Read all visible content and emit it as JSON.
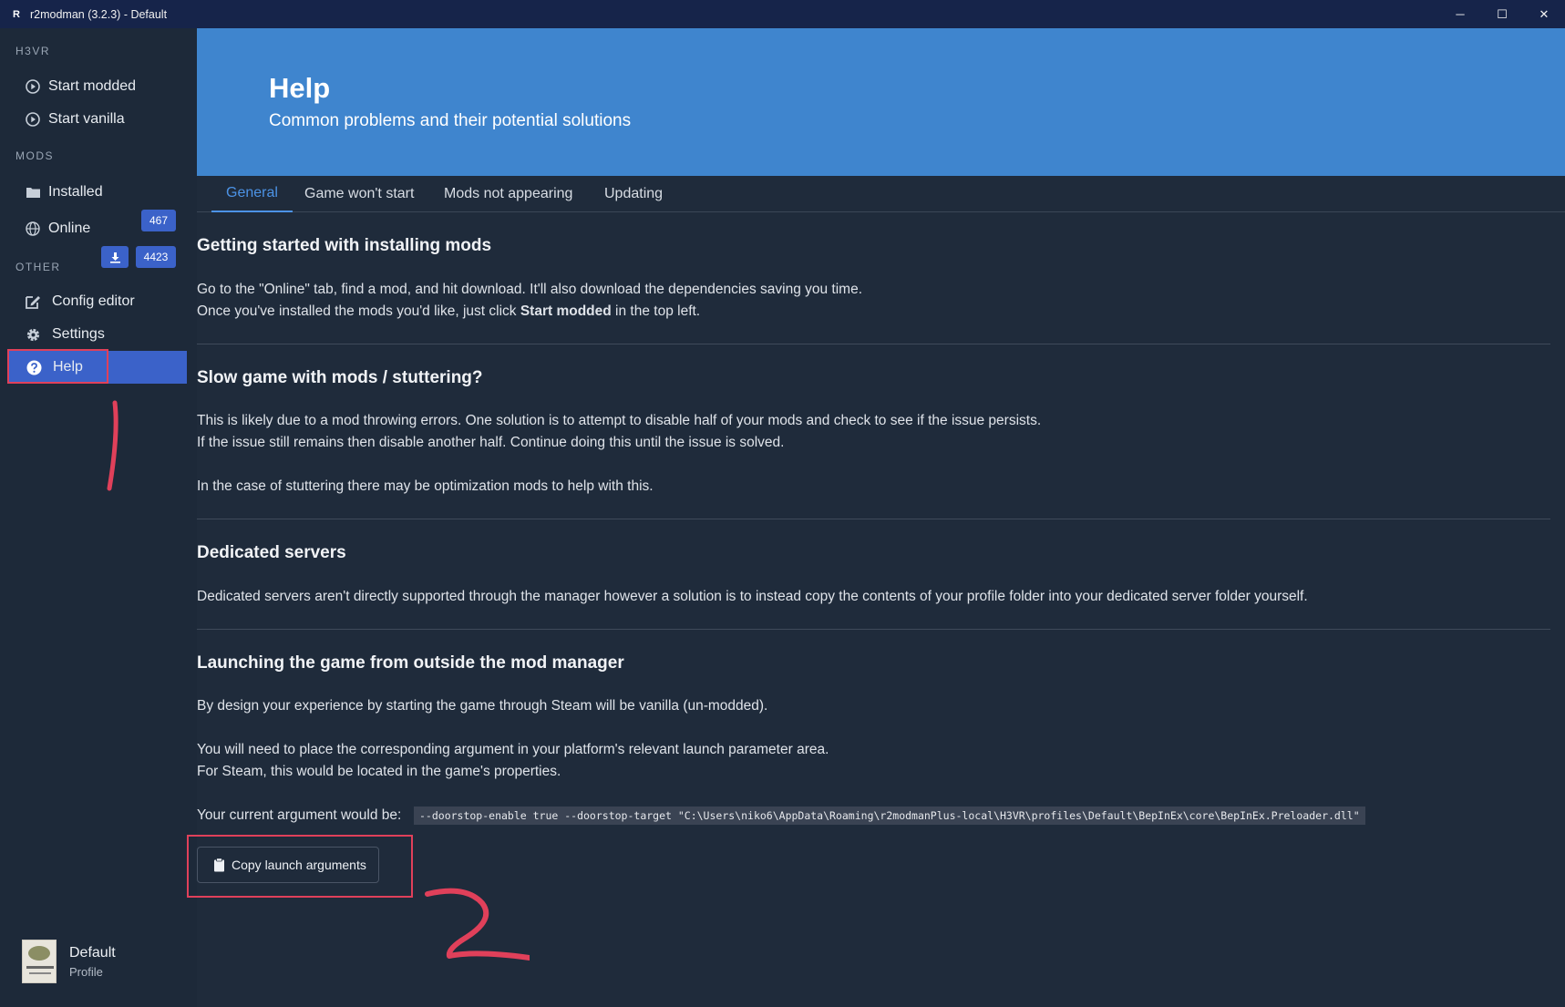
{
  "window": {
    "app_icon_letter": "R",
    "title": "r2modman (3.2.3) - Default",
    "controls": {
      "minimize": "─",
      "maximize": "☐",
      "close": "✕"
    }
  },
  "sidebar": {
    "game_section": "H3VR",
    "start_modded": "Start modded",
    "start_vanilla": "Start vanilla",
    "mods_section": "MODS",
    "installed": {
      "label": "Installed",
      "count": "467"
    },
    "online": {
      "label": "Online",
      "count": "4423"
    },
    "other_section": "OTHER",
    "config_editor": "Config editor",
    "settings": "Settings",
    "help": "Help",
    "profile": {
      "name": "Default",
      "sub": "Profile"
    }
  },
  "hero": {
    "title": "Help",
    "subtitle": "Common problems and their potential solutions"
  },
  "tabs": [
    {
      "label": "General",
      "active": true
    },
    {
      "label": "Game won't start",
      "active": false
    },
    {
      "label": "Mods not appearing",
      "active": false
    },
    {
      "label": "Updating",
      "active": false
    }
  ],
  "sections": {
    "getting_started": {
      "title": "Getting started with installing mods",
      "line1": "Go to the \"Online\" tab, find a mod, and hit download. It'll also download the dependencies saving you time.",
      "line2_pre": "Once you've installed the mods you'd like, just click ",
      "line2_bold": "Start modded",
      "line2_post": " in the top left."
    },
    "slow_game": {
      "title": "Slow game with mods / stuttering?",
      "line1": "This is likely due to a mod throwing errors. One solution is to attempt to disable half of your mods and check to see if the issue persists.",
      "line2": "If the issue still remains then disable another half. Continue doing this until the issue is solved.",
      "line3": "In the case of stuttering there may be optimization mods to help with this."
    },
    "dedicated": {
      "title": "Dedicated servers",
      "line1": "Dedicated servers aren't directly supported through the manager however a solution is to instead copy the contents of your profile folder into your dedicated server folder yourself."
    },
    "launching": {
      "title": "Launching the game from outside the mod manager",
      "line1": "By design your experience by starting the game through Steam will be vanilla (un-modded).",
      "line2": "You will need to place the corresponding argument in your platform's relevant launch parameter area.",
      "line3": "For Steam, this would be located in the game's properties.",
      "argument_label": "Your current argument would be:",
      "argument_value": "--doorstop-enable true --doorstop-target \"C:\\Users\\niko6\\AppData\\Roaming\\r2modmanPlus-local\\H3VR\\profiles\\Default\\BepInEx\\core\\BepInEx.Preloader.dll\"",
      "copy_button": "Copy launch arguments"
    }
  },
  "colors": {
    "accent": "#3b62c9",
    "hero": "#3f85ce",
    "annotation": "#e0405a"
  }
}
